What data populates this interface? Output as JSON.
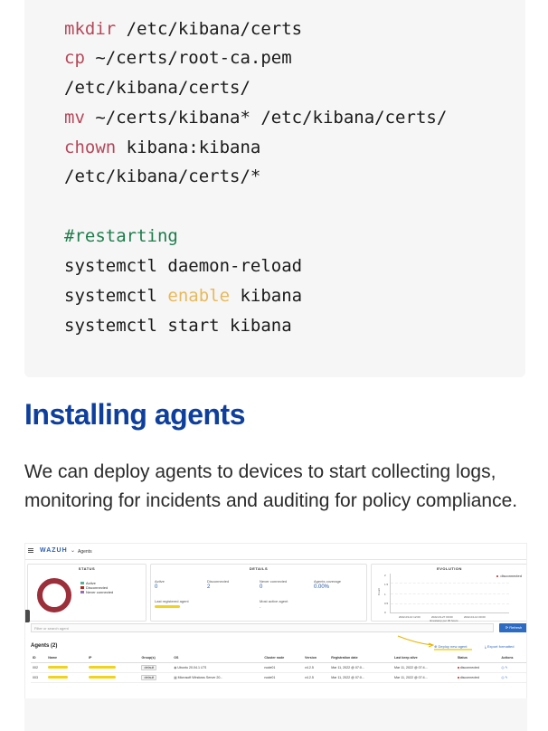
{
  "code": {
    "lines": [
      {
        "kw": "mkdir",
        "rest": " /etc/kibana/certs"
      },
      {
        "kw": "cp",
        "rest": " ~/certs/root-ca.pem"
      },
      {
        "kw": "",
        "rest": "/etc/kibana/certs/"
      },
      {
        "kw": "mv",
        "rest": " ~/certs/kibana* /etc/kibana/certs/"
      },
      {
        "kw": "chown",
        "rest": " kibana:kibana"
      },
      {
        "kw": "",
        "rest": "/etc/kibana/certs/*"
      }
    ],
    "comment": "#restarting",
    "restart_lines": [
      {
        "pre": "systemctl daemon-reload",
        "hl": "",
        "post": ""
      },
      {
        "pre": "systemctl ",
        "hl": "enable",
        "post": " kibana"
      },
      {
        "pre": "systemctl start kibana",
        "hl": "",
        "post": ""
      }
    ]
  },
  "article": {
    "heading": "Installing agents",
    "paragraph": "We can deploy agents to devices to start collecting logs, monitoring for incidents and auditing for policy compliance."
  },
  "dashboard": {
    "brand": "WAZUH",
    "section": "Agents",
    "status_panel": {
      "title": "STATUS",
      "legend": [
        "Active",
        "Disconnected",
        "Never connected"
      ],
      "colors": {
        "active": "#54b399",
        "disconnected": "#bd271e",
        "never": "#9170b8"
      }
    },
    "details_panel": {
      "title": "DETAILS",
      "active_label": "Active",
      "active_value": "0",
      "disconnected_label": "Disconnected",
      "disconnected_value": "2",
      "never_label": "Never connected",
      "never_value": "0",
      "coverage_label": "Agents coverage",
      "coverage_value": "0.00%",
      "last_registered_label": "Last registered agent",
      "most_active_label": "Most active agent",
      "most_active_value": "-"
    },
    "evolution_panel": {
      "title": "EVOLUTION",
      "legend": "disconnected",
      "y_axis": "Count",
      "y_ticks": [
        "2",
        "1.5",
        "1",
        "0.5",
        "0"
      ],
      "x_ticks": [
        "2022-03-10 12:00",
        "2022-03-27 00:00",
        "2022-04-14 00:00"
      ],
      "x_label": "timestamp per 30 hours"
    },
    "search_placeholder": "Filter or search agent",
    "refresh_label": "Refresh",
    "agents_title": "Agents (2)",
    "deploy_label": "Deploy new agent",
    "export_label": "Export formatted",
    "table": {
      "headers": [
        "ID",
        "Name",
        "IP",
        "Group(s)",
        "OS",
        "Cluster node",
        "Version",
        "Registration date",
        "Last keep alive",
        "Status",
        "Actions"
      ],
      "rows": [
        {
          "id": "002",
          "group": "default",
          "os": "Ubuntu 20.04.1 LTS",
          "node": "node01",
          "version": "v4.2.5",
          "registered": "Mar 11, 2022 @ 07:0...",
          "keepalive": "Mar 11, 2022 @ 07:4...",
          "status": "disconnected"
        },
        {
          "id": "003",
          "group": "default",
          "os": "Microsoft Windows Server 20...",
          "node": "node01",
          "version": "v4.2.5",
          "registered": "Mar 11, 2022 @ 07:0...",
          "keepalive": "Mar 11, 2022 @ 07:4...",
          "status": "disconnected"
        }
      ]
    }
  }
}
